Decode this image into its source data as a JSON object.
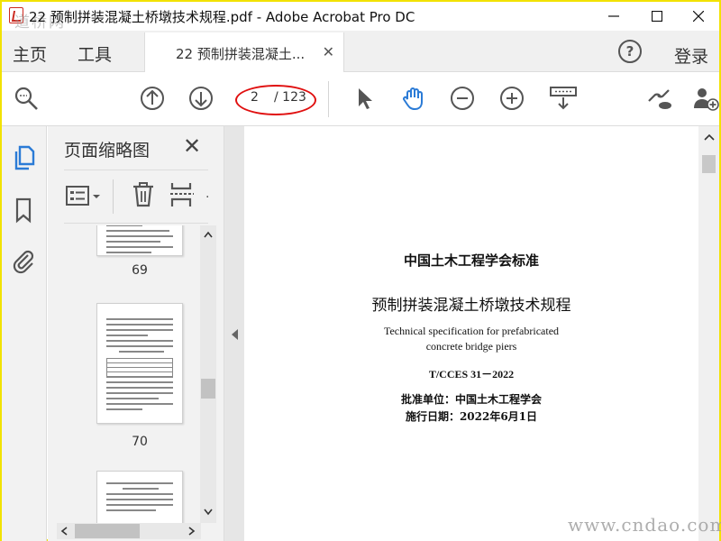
{
  "window": {
    "title": "22 预制拼装混凝土桥墩技术规程.pdf - Adobe Acrobat Pro DC",
    "watermark_top": "道桥网"
  },
  "menu": {
    "home": "主页",
    "tools": "工具",
    "doc_tab": "22 预制拼装混凝土...",
    "login": "登录"
  },
  "toolbar": {
    "current_page": "2",
    "total_pages": "/ 123"
  },
  "panel": {
    "title": "页面缩略图",
    "thumbnails": [
      {
        "label": "69"
      },
      {
        "label": "70"
      },
      {
        "label": ""
      }
    ]
  },
  "document": {
    "org_standard": "中国土木工程学会标准",
    "cn_title": "预制拼装混凝土桥墩技术规程",
    "en_title_1": "Technical specification for prefabricated",
    "en_title_2": "concrete bridge piers",
    "code": "T/CCES 31－2022",
    "approval": "批准单位：中国土木工程学会",
    "effective": "施行日期：2022年6月1日"
  },
  "watermark": "www.cndao.com",
  "colors": {
    "frame": "#f2e200",
    "accent_blue": "#2b7bd6",
    "annotation_red": "#e01010"
  }
}
